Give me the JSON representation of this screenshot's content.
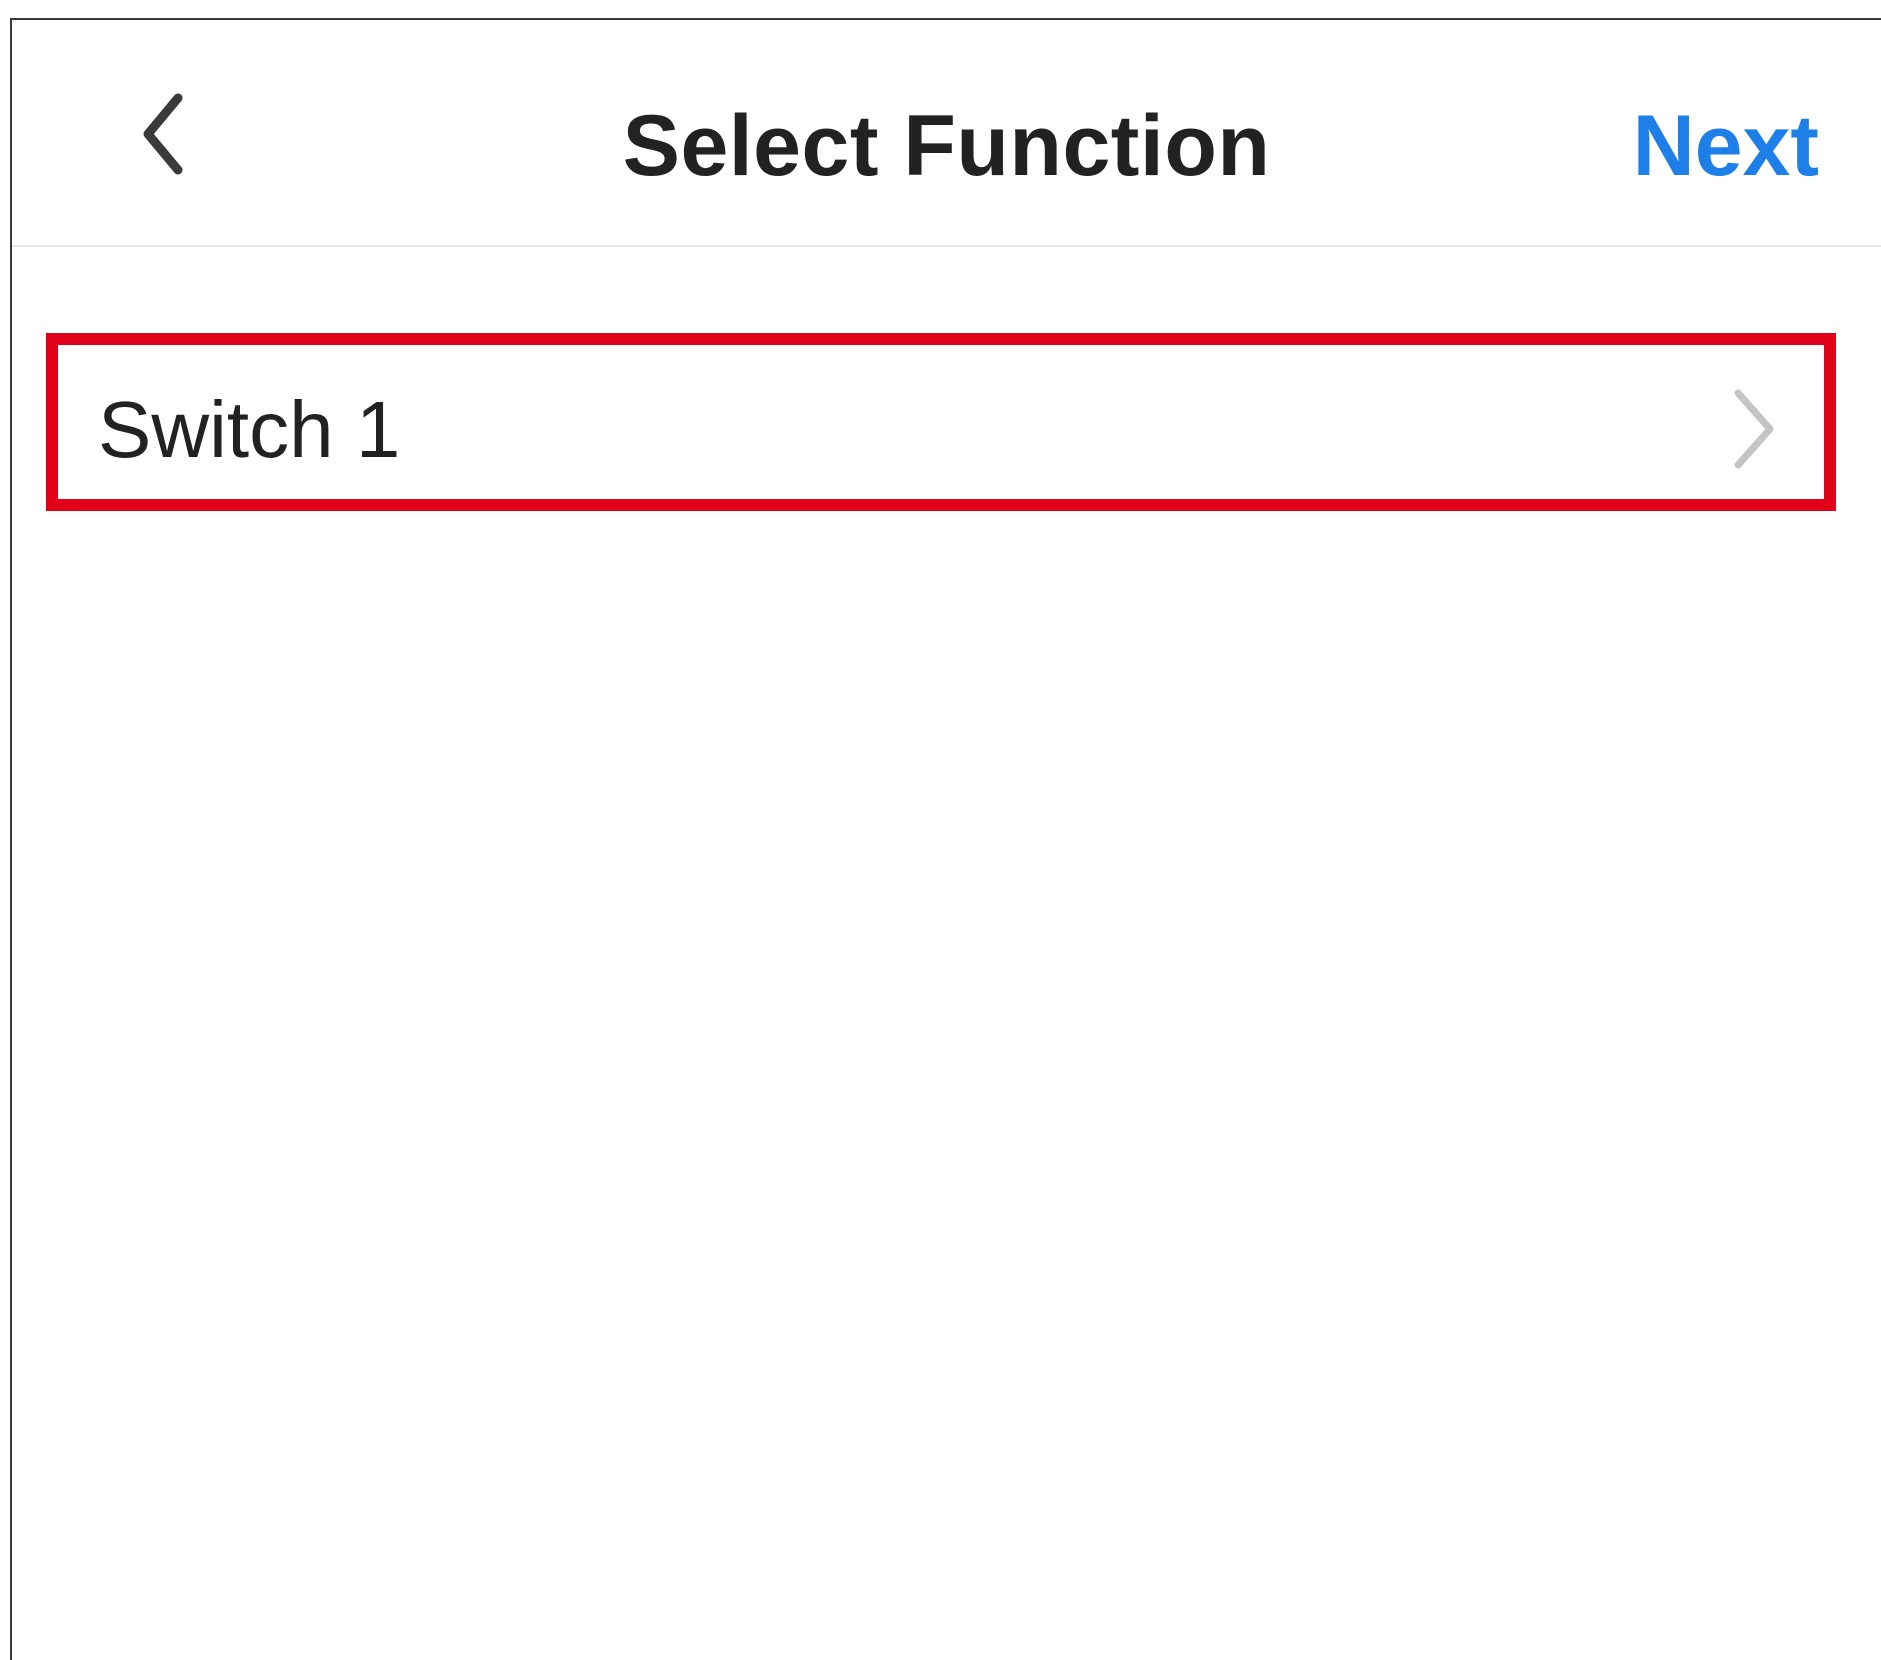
{
  "header": {
    "back_icon": "chevron-left-icon",
    "title": "Select Function",
    "next_label": "Next"
  },
  "list": {
    "items": [
      {
        "label": "Switch 1",
        "icon": "chevron-right-icon"
      }
    ]
  },
  "colors": {
    "accent": "#1e7fe8",
    "highlight": "#e0001a",
    "text": "#222222",
    "chevron": "#c4c4c4"
  }
}
